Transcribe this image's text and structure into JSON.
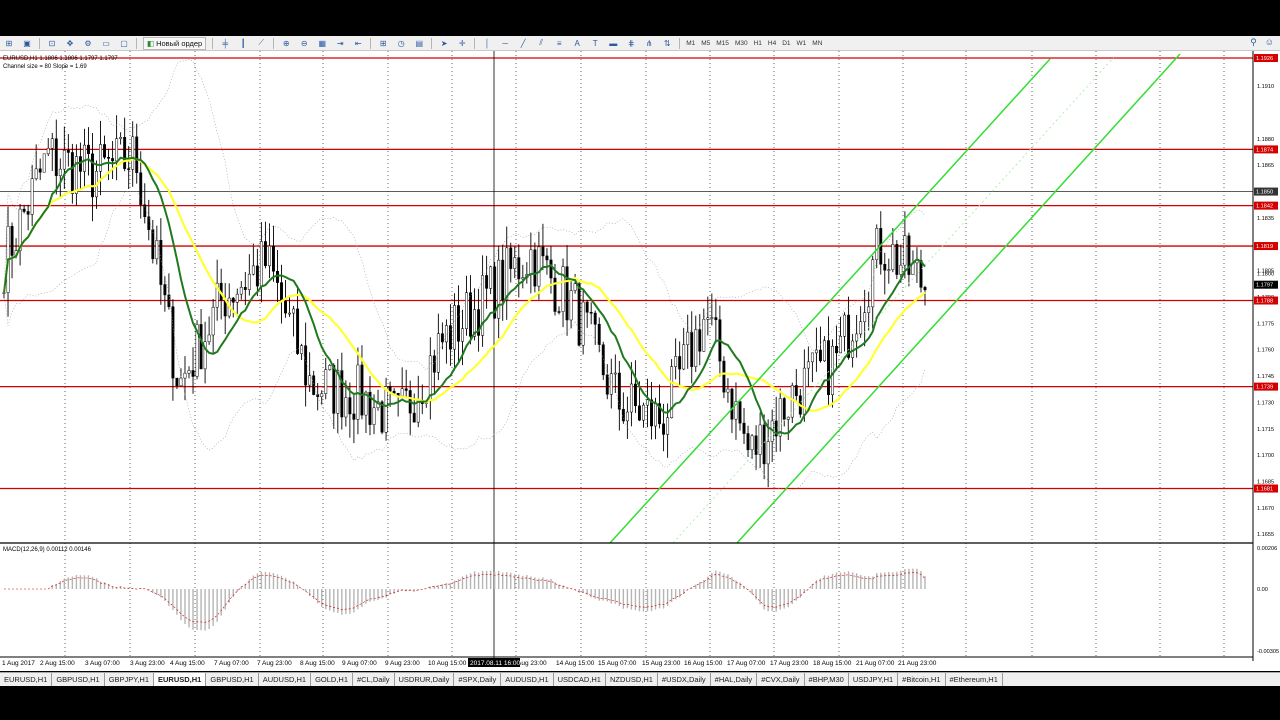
{
  "toolbar": {
    "new_order_label": "Новый ордер",
    "timeframes": [
      "M1",
      "M5",
      "M15",
      "M30",
      "H1",
      "H4",
      "D1",
      "W1",
      "MN"
    ]
  },
  "chart": {
    "title_line": "EURUSD,H1  1.1806 1.1806 1.1797 1.1797",
    "channel_info": "Channel size = 80 Slope = 1.69",
    "macd_label": "MACD(12,26,9) 0.00112 0.00146",
    "crosshair_time": "2017.08.11 16:00"
  },
  "price_scale": {
    "labels": [
      "1.1910",
      "1.1880",
      "1.1865",
      "1.1835",
      "1.1820",
      "1.1805",
      "1.1790",
      "1.1775",
      "1.1760",
      "1.1745",
      "1.1730",
      "1.1715",
      "1.1700",
      "1.1685",
      "1.1670",
      "1.1655"
    ],
    "level_tags": [
      "1.1926",
      "1.1874",
      "1.1842",
      "1.1819",
      "1.1788",
      "1.1739",
      "1.1681"
    ],
    "crosshair_tag": "1.1850",
    "current_tags": [
      "1.1800",
      "1.1797"
    ]
  },
  "macd_scale": {
    "labels": [
      "0.00206",
      "0.00",
      "-0.00305"
    ]
  },
  "time_axis": {
    "labels": [
      "1 Aug 2017",
      "2 Aug 15:00",
      "3 Aug 07:00",
      "3 Aug 23:00",
      "4 Aug 15:00",
      "7 Aug 07:00",
      "7 Aug 23:00",
      "8 Aug 15:00",
      "9 Aug 07:00",
      "9 Aug 23:00",
      "10 Aug 15:00",
      "11 Aug 16:00",
      "Aug 23:00",
      "14 Aug 15:00",
      "15 Aug 07:00",
      "15 Aug 23:00",
      "16 Aug 15:00",
      "17 Aug 07:00",
      "17 Aug 23:00",
      "18 Aug 15:00",
      "21 Aug 07:00",
      "21 Aug 23:00"
    ]
  },
  "tabs": [
    {
      "label": "EURUSD,H1",
      "active": false
    },
    {
      "label": "GBPUSD,H1",
      "active": false
    },
    {
      "label": "GBPJPY,H1",
      "active": false
    },
    {
      "label": "EURUSD,H1",
      "active": true
    },
    {
      "label": "GBPUSD,H1",
      "active": false
    },
    {
      "label": "AUDUSD,H1",
      "active": false
    },
    {
      "label": "GOLD,H1",
      "active": false
    },
    {
      "label": "#CL,Daily",
      "active": false
    },
    {
      "label": "USDRUR,Daily",
      "active": false
    },
    {
      "label": "#SPX,Daily",
      "active": false
    },
    {
      "label": "AUDUSD,H1",
      "active": false
    },
    {
      "label": "USDCAD,H1",
      "active": false
    },
    {
      "label": "NZDUSD,H1",
      "active": false
    },
    {
      "label": "#USDX,Daily",
      "active": false
    },
    {
      "label": "#HAL,Daily",
      "active": false
    },
    {
      "label": "#CVX,Daily",
      "active": false
    },
    {
      "label": "#BHP,M30",
      "active": false
    },
    {
      "label": "USDJPY,H1",
      "active": false
    },
    {
      "label": "#Bitcoin,H1",
      "active": false
    },
    {
      "label": "#Ethereum,H1",
      "active": false
    }
  ],
  "colors": {
    "level_line": "#d40000",
    "channel": "#33dd33",
    "ma_fast": "#1f7a1f",
    "ma_slow": "#ffff33",
    "candles": "#000000"
  },
  "chart_data": {
    "type": "candlestick",
    "symbol": "EURUSD",
    "timeframe": "H1",
    "ylim": [
      1.165,
      1.193
    ],
    "horizontal_levels": [
      1.1926,
      1.1874,
      1.1842,
      1.1819,
      1.1788,
      1.1739,
      1.1681
    ],
    "current_price": 1.1797,
    "close_path": [
      {
        "t": "1 Aug 2017",
        "close": 1.181
      },
      {
        "t": "2 Aug 15:00",
        "close": 1.187
      },
      {
        "t": "3 Aug 07:00",
        "close": 1.186
      },
      {
        "t": "3 Aug 23:00",
        "close": 1.187
      },
      {
        "t": "4 Aug 15:00",
        "close": 1.174
      },
      {
        "t": "7 Aug 07:00",
        "close": 1.179
      },
      {
        "t": "7 Aug 23:00",
        "close": 1.181
      },
      {
        "t": "8 Aug 15:00",
        "close": 1.174
      },
      {
        "t": "9 Aug 07:00",
        "close": 1.1735
      },
      {
        "t": "9 Aug 23:00",
        "close": 1.172
      },
      {
        "t": "10 Aug 15:00",
        "close": 1.1765
      },
      {
        "t": "11 Aug 16:00",
        "close": 1.179
      },
      {
        "t": "Aug 23:00",
        "close": 1.1815
      },
      {
        "t": "14 Aug 15:00",
        "close": 1.1785
      },
      {
        "t": "15 Aug 07:00",
        "close": 1.173
      },
      {
        "t": "15 Aug 23:00",
        "close": 1.172
      },
      {
        "t": "16 Aug 15:00",
        "close": 1.178
      },
      {
        "t": "17 Aug 07:00",
        "close": 1.17
      },
      {
        "t": "17 Aug 23:00",
        "close": 1.1735
      },
      {
        "t": "18 Aug 15:00",
        "close": 1.1755
      },
      {
        "t": "21 Aug 07:00",
        "close": 1.182
      },
      {
        "t": "21 Aug 23:00",
        "close": 1.1797
      }
    ]
  }
}
